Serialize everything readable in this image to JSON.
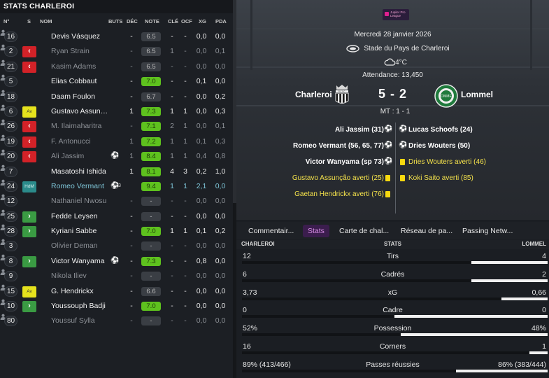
{
  "left_panel": {
    "title": "STATS CHARLEROI",
    "headers": {
      "num": "N°",
      "sub": "S",
      "name": "NOM",
      "buts": "BUTS",
      "dec": "DÉC",
      "note": "NOTE",
      "cle": "CLÉ",
      "ocf": "OCF",
      "xg": "XG",
      "pda": "PDA"
    },
    "players": [
      {
        "num": "16",
        "sub": "",
        "name": "Devis Vásquez",
        "style": "normal",
        "buts": "",
        "dec": "-",
        "note": "6.5",
        "note_color": "grey",
        "cle": "-",
        "ocf": "-",
        "xg": "0,0",
        "pda": "0,0"
      },
      {
        "num": "2",
        "sub": "out",
        "name": "Ryan Strain",
        "style": "dim",
        "buts": "",
        "dec": "-",
        "note": "6.5",
        "note_color": "grey",
        "cle": "1",
        "ocf": "-",
        "xg": "0,0",
        "pda": "0,1"
      },
      {
        "num": "21",
        "sub": "out",
        "name": "Kasim Adams",
        "style": "dim",
        "buts": "",
        "dec": "-",
        "note": "6.5",
        "note_color": "grey",
        "cle": "-",
        "ocf": "-",
        "xg": "0,0",
        "pda": "0,0"
      },
      {
        "num": "5",
        "sub": "",
        "name": "Elias Cobbaut",
        "style": "normal",
        "buts": "",
        "dec": "-",
        "note": "7.0",
        "note_color": "green",
        "cle": "-",
        "ocf": "-",
        "xg": "0,1",
        "pda": "0,0"
      },
      {
        "num": "18",
        "sub": "",
        "name": "Daam Foulon",
        "style": "normal",
        "buts": "",
        "dec": "-",
        "note": "6.7",
        "note_color": "grey",
        "cle": "-",
        "ocf": "-",
        "xg": "0,0",
        "pda": "0,2"
      },
      {
        "num": "6",
        "sub": "pos",
        "sub_label": "Av",
        "name": "Gustavo Assunç...",
        "style": "normal",
        "buts": "",
        "dec": "1",
        "note": "7.3",
        "note_color": "green",
        "cle": "1",
        "ocf": "1",
        "xg": "0,0",
        "pda": "0,3"
      },
      {
        "num": "26",
        "sub": "out",
        "name": "M. Ilaimaharitra",
        "style": "dim",
        "buts": "",
        "dec": "-",
        "note": "7.1",
        "note_color": "green",
        "cle": "2",
        "ocf": "1",
        "xg": "0,0",
        "pda": "0,1"
      },
      {
        "num": "19",
        "sub": "out",
        "name": "F. Antonucci",
        "style": "dim",
        "buts": "",
        "dec": "1",
        "note": "7.2",
        "note_color": "green",
        "cle": "1",
        "ocf": "1",
        "xg": "0,1",
        "pda": "0,3"
      },
      {
        "num": "20",
        "sub": "out",
        "name": "Ali Jassim",
        "style": "dim",
        "buts": "ball",
        "dec": "1",
        "note": "8.4",
        "note_color": "green",
        "cle": "1",
        "ocf": "1",
        "xg": "0,4",
        "pda": "0,8"
      },
      {
        "num": "7",
        "sub": "",
        "name": "Masatoshi Ishida",
        "style": "normal",
        "buts": "",
        "dec": "1",
        "note": "8.1",
        "note_color": "green",
        "cle": "4",
        "ocf": "3",
        "xg": "0,2",
        "pda": "1,0"
      },
      {
        "num": "24",
        "sub": "posteal",
        "sub_label": "HdM",
        "name": "Romeo Vermant",
        "style": "teal",
        "buts": "ball",
        "buts_count": "3",
        "dec": "",
        "note": "9.4",
        "note_color": "green",
        "cle": "1",
        "ocf": "1",
        "xg": "2,1",
        "pda": "0,0"
      },
      {
        "num": "12",
        "sub": "",
        "name": "Nathaniel Nwosu",
        "style": "dim",
        "buts": "",
        "dec": "-",
        "note": "-",
        "note_color": "grey",
        "cle": "-",
        "ocf": "-",
        "xg": "0,0",
        "pda": "0,0"
      },
      {
        "num": "25",
        "sub": "in",
        "name": "Fedde Leysen",
        "style": "normal",
        "buts": "",
        "dec": "-",
        "note": "-",
        "note_color": "grey",
        "cle": "-",
        "ocf": "-",
        "xg": "0,0",
        "pda": "0,0"
      },
      {
        "num": "28",
        "sub": "in",
        "name": "Kyriani Sabbe",
        "style": "normal",
        "buts": "",
        "dec": "-",
        "note": "7.0",
        "note_color": "green",
        "cle": "1",
        "ocf": "1",
        "xg": "0,1",
        "pda": "0,2"
      },
      {
        "num": "3",
        "sub": "",
        "name": "Olivier Deman",
        "style": "dim",
        "buts": "",
        "dec": "-",
        "note": "-",
        "note_color": "grey",
        "cle": "-",
        "ocf": "-",
        "xg": "0,0",
        "pda": "0,0"
      },
      {
        "num": "8",
        "sub": "in",
        "name": "Victor Wanyama",
        "style": "normal",
        "buts": "ball",
        "dec": "-",
        "note": "7.3",
        "note_color": "green",
        "cle": "-",
        "ocf": "-",
        "xg": "0,8",
        "pda": "0,0"
      },
      {
        "num": "9",
        "sub": "",
        "name": "Nikola Iliev",
        "style": "dim",
        "buts": "",
        "dec": "-",
        "note": "-",
        "note_color": "grey",
        "cle": "-",
        "ocf": "-",
        "xg": "0,0",
        "pda": "0,0"
      },
      {
        "num": "15",
        "sub": "pos",
        "sub_label": "Av",
        "name": "G. Hendrickx",
        "style": "normal",
        "buts": "",
        "dec": "-",
        "note": "6.6",
        "note_color": "grey",
        "cle": "-",
        "ocf": "-",
        "xg": "0,0",
        "pda": "0,0"
      },
      {
        "num": "10",
        "sub": "in",
        "name": "Youssouph Badji",
        "style": "normal",
        "buts": "",
        "dec": "-",
        "note": "7.0",
        "note_color": "green",
        "cle": "-",
        "ocf": "-",
        "xg": "0,0",
        "pda": "0,0"
      },
      {
        "num": "80",
        "sub": "",
        "name": "Youssuf Sylla",
        "style": "dim",
        "buts": "",
        "dec": "-",
        "note": "-",
        "note_color": "grey",
        "cle": "-",
        "ocf": "-",
        "xg": "0,0",
        "pda": "0,0"
      }
    ]
  },
  "match": {
    "league_logo_text": "Jupiler Pro League",
    "date": "Mercredi 28 janvier 2026",
    "stadium": "Stade du Pays de Charleroi",
    "weather": "4°C",
    "attendance": "Attendance: 13,450",
    "home_team": "Charleroi",
    "away_team": "Lommel",
    "home_crest_text": "R.C.S.C.",
    "away_crest_text": "LOMMEL",
    "score": "5 - 2",
    "halftime": "MT : 1 - 1",
    "home_events": [
      {
        "text": "Ali Jassim (31)",
        "type": "goal"
      },
      {
        "text": "Romeo Vermant (56, 65, 77)",
        "type": "goal"
      },
      {
        "text": "Victor Wanyama (sp 73)",
        "type": "goal"
      },
      {
        "text": "Gustavo Assunção averti (25)",
        "type": "card"
      },
      {
        "text": "Gaetan Hendrickx averti (76)",
        "type": "card"
      }
    ],
    "away_events": [
      {
        "text": "Lucas Schoofs (24)",
        "type": "goal"
      },
      {
        "text": "Dries Wouters (50)",
        "type": "goal"
      },
      {
        "text": "Dries Wouters averti (46)",
        "type": "card"
      },
      {
        "text": "Koki Saito averti (85)",
        "type": "card"
      }
    ]
  },
  "tabs": [
    {
      "label": "Commentair...",
      "active": false
    },
    {
      "label": "Stats",
      "active": true
    },
    {
      "label": "Carte de chal...",
      "active": false
    },
    {
      "label": "Réseau de pa...",
      "active": false
    },
    {
      "label": "Passing Netw...",
      "active": false
    }
  ],
  "stats": {
    "home_label": "CHARLEROI",
    "center_label": "STATS",
    "away_label": "LOMMEL",
    "rows": [
      {
        "label": "Tirs",
        "home": "12",
        "away": "4",
        "away_share": 0.25
      },
      {
        "label": "Cadrés",
        "home": "6",
        "away": "2",
        "away_share": 0.25
      },
      {
        "label": "xG",
        "home": "3,73",
        "away": "0,66",
        "away_share": 0.15
      },
      {
        "label": "Cadre",
        "home": "0",
        "away": "0",
        "away_share": 0.5
      },
      {
        "label": "Possession",
        "home": "52%",
        "away": "48%",
        "away_share": 0.48
      },
      {
        "label": "Corners",
        "home": "16",
        "away": "1",
        "away_share": 0.06
      },
      {
        "label": "Passes réussies",
        "home": "89% (413/466)",
        "away": "86% (383/444)",
        "away_share": 0.3
      }
    ]
  },
  "colors": {
    "accent_tab": "#d88de6",
    "note_green": "#5ec11e",
    "sub_out": "#d32228",
    "sub_in": "#3a9b43",
    "card_yellow": "#f7d90f"
  }
}
